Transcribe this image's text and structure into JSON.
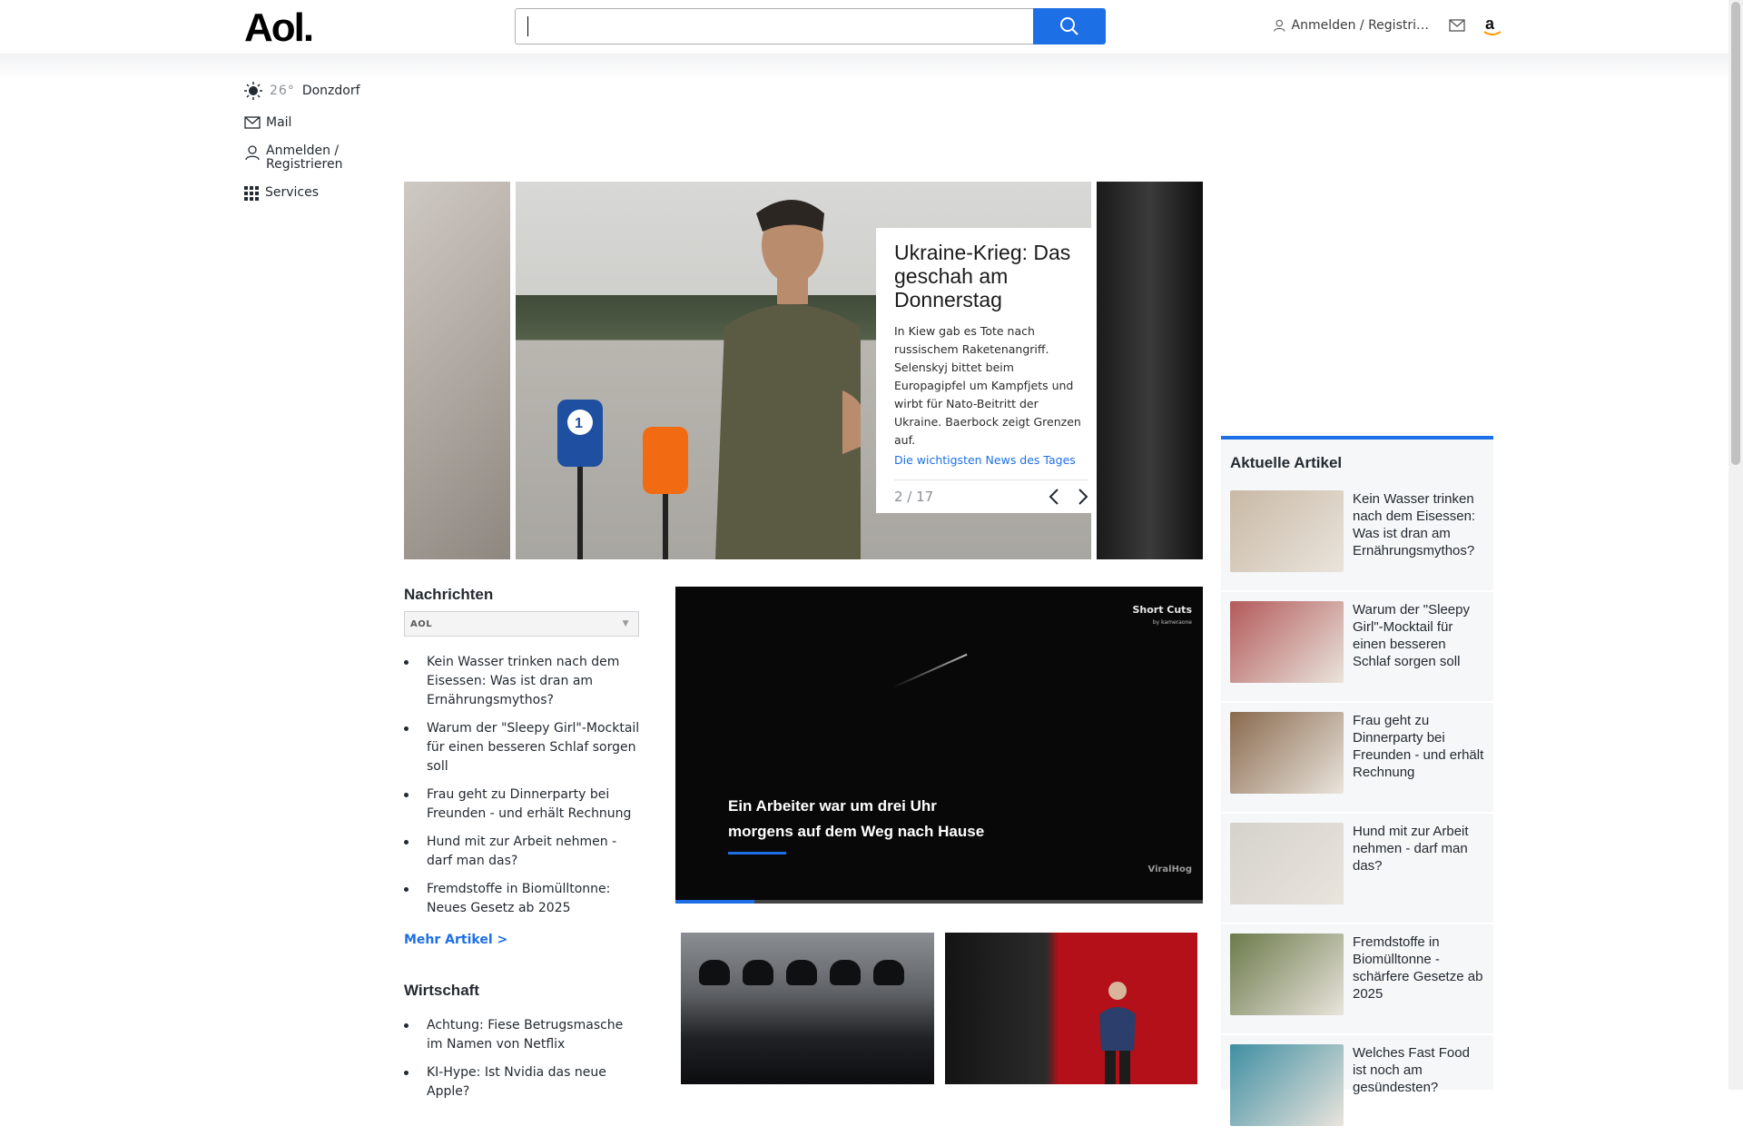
{
  "header": {
    "logo": "Aol.",
    "search_placeholder": "",
    "signin_label": "Anmelden / Registri…",
    "icons": [
      "search-icon",
      "user-icon",
      "mail-icon",
      "amazon-icon"
    ]
  },
  "leftnav": {
    "temperature": "26°",
    "location": "Donzdorf",
    "mail": "Mail",
    "signin": "Anmelden / Registrieren",
    "services": "Services"
  },
  "hero": {
    "title": "Ukraine-Krieg: Das geschah am Donnerstag",
    "description": "In Kiew gab es Tote nach russischem Raketenangriff. Selenskyj bittet beim Europagipfel um Kampfjets und wirbt für Nato-Beitritt der Ukraine. Baerbock zeigt Grenzen auf.",
    "link": "Die wichtigsten News des Tages",
    "pager": "2 / 17"
  },
  "aktuell": {
    "title": "Aktuelle Artikel",
    "items": [
      {
        "text": "Kein Wasser trinken nach dem Eisessen: Was ist dran am Ernährungsmythos?",
        "color": "#c9b9a5"
      },
      {
        "text": "Warum der \"Sleepy Girl\"-Mocktail für einen besseren Schlaf sorgen soll",
        "color": "#b35a5a"
      },
      {
        "text": "Frau geht zu Dinnerparty bei Freunden - und erhält Rechnung",
        "color": "#8a6a4e"
      },
      {
        "text": "Hund mit zur Arbeit nehmen - darf man das?",
        "color": "#d5d2cc"
      },
      {
        "text": "Fremdstoffe in Biomülltonne - schärfere Gesetze ab 2025",
        "color": "#6b7a4a"
      },
      {
        "text": "Welches Fast Food ist noch am gesündesten?",
        "color": "#3f8fa3"
      }
    ]
  },
  "news": {
    "title": "Nachrichten",
    "select_value": "AOL",
    "items": [
      "Kein Wasser trinken nach dem Eisessen: Was ist dran am Ernährungsmythos?",
      "Warum der \"Sleepy Girl\"-Mocktail für einen besseren Schlaf sorgen soll",
      "Frau geht zu Dinnerparty bei Freunden - und erhält Rechnung",
      "Hund mit zur Arbeit nehmen - darf man das?",
      "Fremdstoffe in Biomülltonne: Neues Gesetz ab 2025"
    ],
    "more": "Mehr Artikel >"
  },
  "wirtschaft": {
    "title": "Wirtschaft",
    "items": [
      "Achtung: Fiese Betrugsmasche im Namen von Netflix",
      "KI-Hype: Ist Nvidia das neue Apple?"
    ]
  },
  "video": {
    "caption_line1": "Ein Arbeiter war um drei Uhr",
    "caption_line2": "morgens auf dem Weg nach Hause",
    "brand": "Short Cuts",
    "brand_sub": "by kameraone",
    "watermark": "ViralHog",
    "progress": 0.15
  },
  "colors": {
    "accent": "#1d6fe6"
  }
}
